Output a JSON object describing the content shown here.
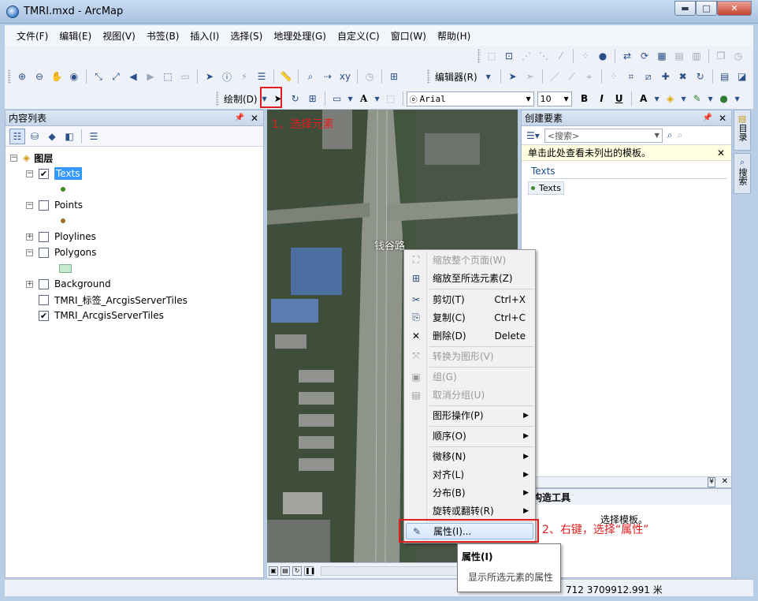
{
  "window": {
    "title": "TMRI.mxd - ArcMap",
    "minimize": "▬",
    "maximize": "□",
    "close": "✕"
  },
  "menu": [
    "文件(F)",
    "编辑(E)",
    "视图(V)",
    "书签(B)",
    "插入(I)",
    "选择(S)",
    "地理处理(G)",
    "自定义(C)",
    "窗口(W)",
    "帮助(H)"
  ],
  "toolbar": {
    "editor_label": "编辑器(R)",
    "draw_label": "绘制(D)",
    "font_name": "Arial",
    "font_size": "10",
    "bold": "B",
    "italic": "I",
    "underline": "U",
    "text_tool": "A"
  },
  "toc": {
    "title": "内容列表",
    "layers_root": "图层",
    "layers": [
      {
        "name": "Texts",
        "checked": "✔",
        "expander": "−"
      },
      {
        "name": "Points",
        "checked": "",
        "expander": "−"
      },
      {
        "name": "Ploylines",
        "checked": "",
        "expander": "+"
      },
      {
        "name": "Polygons",
        "checked": "",
        "expander": "−"
      },
      {
        "name": "Background",
        "checked": "",
        "expander": "+"
      },
      {
        "name": "TMRI_标签_ArcgisServerTiles",
        "checked": ""
      },
      {
        "name": "TMRI_ArcgisServerTiles",
        "checked": "✔"
      }
    ],
    "texts_symbol_color": "#3f8a2a",
    "points_symbol_color": "#9a6a26"
  },
  "map": {
    "road_label": "钱谷路"
  },
  "create_features": {
    "title": "创建要素",
    "search_placeholder": "<搜索>",
    "info_bar": "单击此处查看未列出的模板。",
    "group": "Texts",
    "template": "Texts"
  },
  "construct_tools": {
    "title": "构造工具",
    "hint": "选择模板。"
  },
  "right_tabs": [
    "目录",
    "搜索"
  ],
  "context_menu": [
    {
      "label": "缩放整个页面(W)",
      "shortcut": "",
      "icon": "⛶",
      "disabled": true,
      "submenu": false
    },
    {
      "label": "缩放至所选元素(Z)",
      "shortcut": "",
      "icon": "⊞",
      "disabled": false,
      "submenu": false
    },
    {
      "label": "剪切(T)",
      "shortcut": "Ctrl+X",
      "icon": "✂",
      "disabled": false,
      "submenu": false
    },
    {
      "label": "复制(C)",
      "shortcut": "Ctrl+C",
      "icon": "⎘",
      "disabled": false,
      "submenu": false
    },
    {
      "label": "删除(D)",
      "shortcut": "Delete",
      "icon": "✕",
      "disabled": false,
      "submenu": false
    },
    {
      "label": "转换为图形(V)",
      "shortcut": "",
      "icon": "⤧",
      "disabled": true,
      "submenu": false
    },
    {
      "label": "组(G)",
      "shortcut": "",
      "icon": "▣",
      "disabled": true,
      "submenu": false
    },
    {
      "label": "取消分组(U)",
      "shortcut": "",
      "icon": "▤",
      "disabled": true,
      "submenu": false
    },
    {
      "label": "图形操作(P)",
      "shortcut": "",
      "icon": "",
      "disabled": false,
      "submenu": true
    },
    {
      "label": "顺序(O)",
      "shortcut": "",
      "icon": "",
      "disabled": false,
      "submenu": true
    },
    {
      "label": "微移(N)",
      "shortcut": "",
      "icon": "",
      "disabled": false,
      "submenu": true
    },
    {
      "label": "对齐(L)",
      "shortcut": "",
      "icon": "",
      "disabled": false,
      "submenu": true
    },
    {
      "label": "分布(B)",
      "shortcut": "",
      "icon": "",
      "disabled": false,
      "submenu": true
    },
    {
      "label": "旋转或翻转(R)",
      "shortcut": "",
      "icon": "",
      "disabled": false,
      "submenu": true
    },
    {
      "label": "属性(I)...",
      "shortcut": "",
      "icon": "✎",
      "disabled": false,
      "submenu": false
    }
  ],
  "tooltip": {
    "title": "属性(I)",
    "description": "显示所选元素的属性"
  },
  "status": {
    "coords": "712  3709912.991 米"
  },
  "annotations": {
    "step1": "1、选择元素",
    "step2": "2、右键，选择“属性”"
  },
  "colors": {
    "annotation_red": "#e02020",
    "selection_blue": "#3399ff"
  }
}
